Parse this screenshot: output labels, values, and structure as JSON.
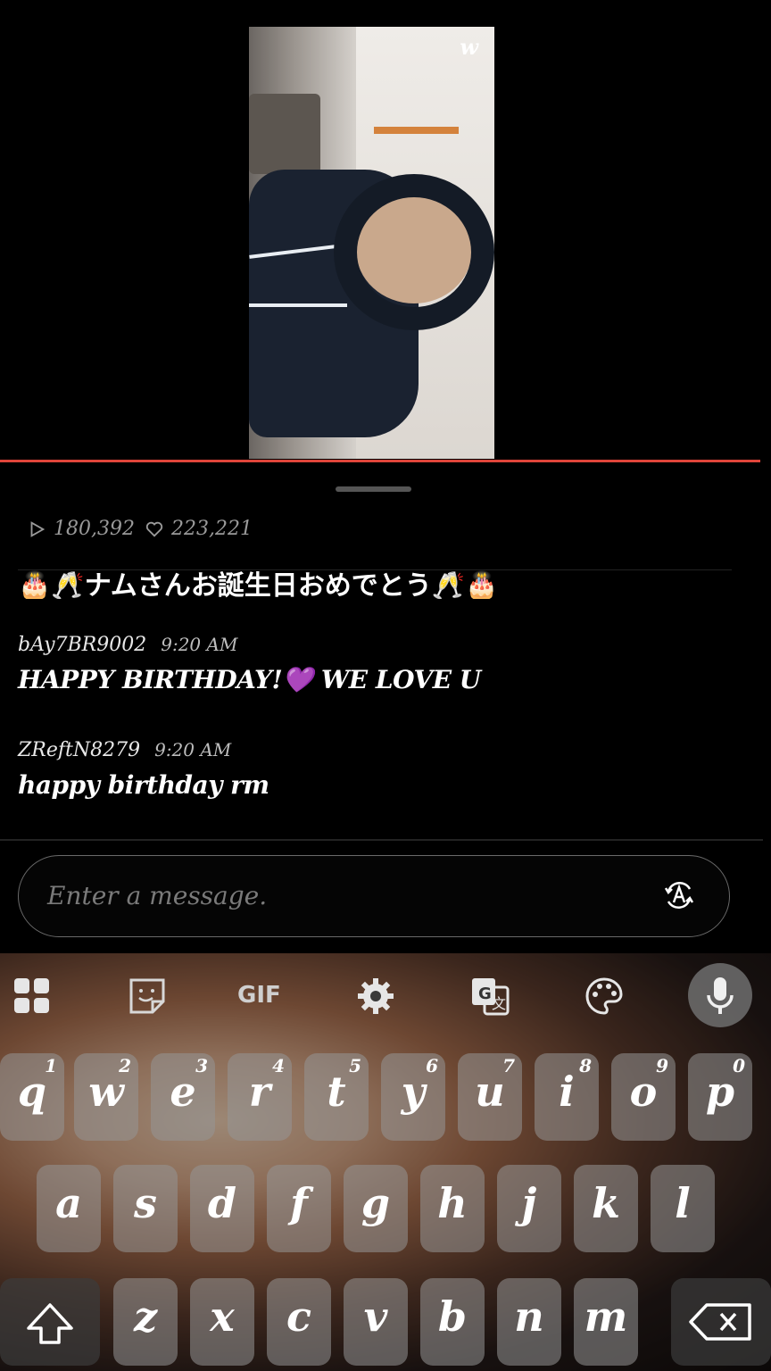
{
  "video": {
    "logo": "w"
  },
  "stats": {
    "plays": "180,392",
    "likes": "223,221"
  },
  "pinned": {
    "text": "🎂🥂ナムさんお誕生日おめでとう🥂🎂"
  },
  "comments": [
    {
      "user": "bAy7BR9002",
      "time": "9:20 AM",
      "message": "HAPPY BIRTHDAY!💜  WE LOVE U"
    },
    {
      "user": "ZReftN8279",
      "time": "9:20 AM",
      "message": "happy birthday rm"
    }
  ],
  "input": {
    "placeholder": "Enter a message."
  },
  "keyboard": {
    "toolbar": {
      "gif_label": "GIF"
    },
    "row1": [
      {
        "ch": "q",
        "num": "1"
      },
      {
        "ch": "w",
        "num": "2"
      },
      {
        "ch": "e",
        "num": "3"
      },
      {
        "ch": "r",
        "num": "4"
      },
      {
        "ch": "t",
        "num": "5"
      },
      {
        "ch": "y",
        "num": "6"
      },
      {
        "ch": "u",
        "num": "7"
      },
      {
        "ch": "i",
        "num": "8"
      },
      {
        "ch": "o",
        "num": "9"
      },
      {
        "ch": "p",
        "num": "0"
      }
    ],
    "row2": [
      "a",
      "s",
      "d",
      "f",
      "g",
      "h",
      "j",
      "k",
      "l"
    ],
    "row3": [
      "z",
      "x",
      "c",
      "v",
      "b",
      "n",
      "m"
    ]
  },
  "colors": {
    "accent_line": "#e0453a",
    "background": "#000000"
  },
  "icons": [
    "play-icon",
    "heart-icon",
    "translate-icon",
    "apps-grid-icon",
    "sticker-icon",
    "gif-icon",
    "settings-icon",
    "google-translate-icon",
    "palette-icon",
    "mic-icon",
    "shift-icon",
    "backspace-icon"
  ]
}
